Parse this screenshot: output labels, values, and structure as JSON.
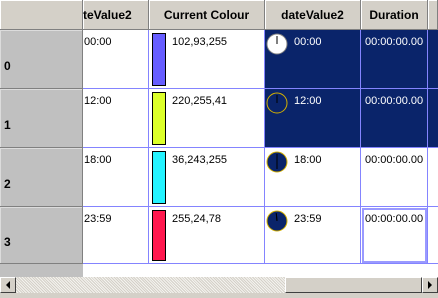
{
  "columns": [
    {
      "label": "teValue2"
    },
    {
      "label": "Current Colour"
    },
    {
      "label": "dateValue2"
    },
    {
      "label": "Duration"
    }
  ],
  "rows": [
    {
      "header": "0",
      "time_cut": "00:00",
      "colour_text": "102,93,255",
      "colour_hex": "#665dff",
      "clock_text": "00:00",
      "duration": "00:00:00.00",
      "selected": true,
      "clock_style": "white"
    },
    {
      "header": "1",
      "time_cut": "12:00",
      "colour_text": "220,255,41",
      "colour_hex": "#dcff29",
      "clock_text": "12:00",
      "duration": "00:00:00.00",
      "selected": true,
      "clock_style": "navy"
    },
    {
      "header": "2",
      "time_cut": "18:00",
      "colour_text": "36,243,255",
      "colour_hex": "#24f3ff",
      "clock_text": "18:00",
      "duration": "00:00:00.00",
      "selected": false,
      "clock_style": "navy"
    },
    {
      "header": "3",
      "time_cut": "23:59",
      "colour_text": "255,24,78",
      "colour_hex": "#ff184e",
      "clock_text": "23:59",
      "duration": "00:00:00.00",
      "selected": false,
      "clock_style": "navy"
    }
  ],
  "icons": {
    "scroll_left": "arrow-left-icon",
    "scroll_right": "arrow-right-icon",
    "clock": "clock-icon"
  },
  "colors": {
    "selection": "#0a246a",
    "gridline": "#8484ff",
    "header_bg": "#d4d0c8"
  }
}
